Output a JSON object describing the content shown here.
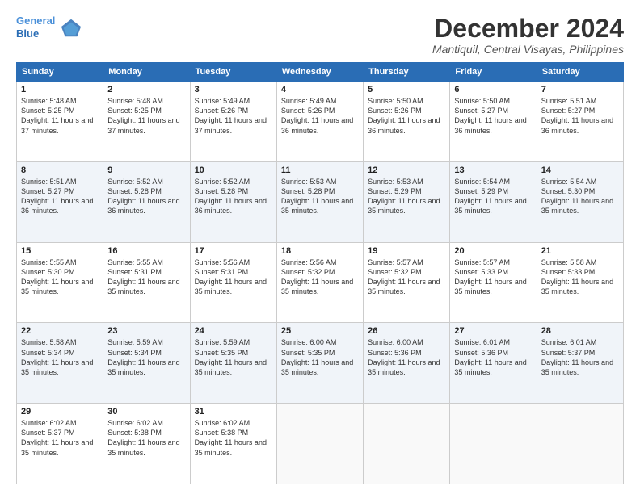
{
  "header": {
    "logo_line1": "General",
    "logo_line2": "Blue",
    "month": "December 2024",
    "location": "Mantiquil, Central Visayas, Philippines"
  },
  "weekdays": [
    "Sunday",
    "Monday",
    "Tuesday",
    "Wednesday",
    "Thursday",
    "Friday",
    "Saturday"
  ],
  "weeks": [
    [
      {
        "day": "1",
        "rise": "5:48 AM",
        "set": "5:25 PM",
        "daylight": "11 hours and 37 minutes."
      },
      {
        "day": "2",
        "rise": "5:48 AM",
        "set": "5:25 PM",
        "daylight": "11 hours and 37 minutes."
      },
      {
        "day": "3",
        "rise": "5:49 AM",
        "set": "5:26 PM",
        "daylight": "11 hours and 37 minutes."
      },
      {
        "day": "4",
        "rise": "5:49 AM",
        "set": "5:26 PM",
        "daylight": "11 hours and 36 minutes."
      },
      {
        "day": "5",
        "rise": "5:50 AM",
        "set": "5:26 PM",
        "daylight": "11 hours and 36 minutes."
      },
      {
        "day": "6",
        "rise": "5:50 AM",
        "set": "5:27 PM",
        "daylight": "11 hours and 36 minutes."
      },
      {
        "day": "7",
        "rise": "5:51 AM",
        "set": "5:27 PM",
        "daylight": "11 hours and 36 minutes."
      }
    ],
    [
      {
        "day": "8",
        "rise": "5:51 AM",
        "set": "5:27 PM",
        "daylight": "11 hours and 36 minutes."
      },
      {
        "day": "9",
        "rise": "5:52 AM",
        "set": "5:28 PM",
        "daylight": "11 hours and 36 minutes."
      },
      {
        "day": "10",
        "rise": "5:52 AM",
        "set": "5:28 PM",
        "daylight": "11 hours and 36 minutes."
      },
      {
        "day": "11",
        "rise": "5:53 AM",
        "set": "5:28 PM",
        "daylight": "11 hours and 35 minutes."
      },
      {
        "day": "12",
        "rise": "5:53 AM",
        "set": "5:29 PM",
        "daylight": "11 hours and 35 minutes."
      },
      {
        "day": "13",
        "rise": "5:54 AM",
        "set": "5:29 PM",
        "daylight": "11 hours and 35 minutes."
      },
      {
        "day": "14",
        "rise": "5:54 AM",
        "set": "5:30 PM",
        "daylight": "11 hours and 35 minutes."
      }
    ],
    [
      {
        "day": "15",
        "rise": "5:55 AM",
        "set": "5:30 PM",
        "daylight": "11 hours and 35 minutes."
      },
      {
        "day": "16",
        "rise": "5:55 AM",
        "set": "5:31 PM",
        "daylight": "11 hours and 35 minutes."
      },
      {
        "day": "17",
        "rise": "5:56 AM",
        "set": "5:31 PM",
        "daylight": "11 hours and 35 minutes."
      },
      {
        "day": "18",
        "rise": "5:56 AM",
        "set": "5:32 PM",
        "daylight": "11 hours and 35 minutes."
      },
      {
        "day": "19",
        "rise": "5:57 AM",
        "set": "5:32 PM",
        "daylight": "11 hours and 35 minutes."
      },
      {
        "day": "20",
        "rise": "5:57 AM",
        "set": "5:33 PM",
        "daylight": "11 hours and 35 minutes."
      },
      {
        "day": "21",
        "rise": "5:58 AM",
        "set": "5:33 PM",
        "daylight": "11 hours and 35 minutes."
      }
    ],
    [
      {
        "day": "22",
        "rise": "5:58 AM",
        "set": "5:34 PM",
        "daylight": "11 hours and 35 minutes."
      },
      {
        "day": "23",
        "rise": "5:59 AM",
        "set": "5:34 PM",
        "daylight": "11 hours and 35 minutes."
      },
      {
        "day": "24",
        "rise": "5:59 AM",
        "set": "5:35 PM",
        "daylight": "11 hours and 35 minutes."
      },
      {
        "day": "25",
        "rise": "6:00 AM",
        "set": "5:35 PM",
        "daylight": "11 hours and 35 minutes."
      },
      {
        "day": "26",
        "rise": "6:00 AM",
        "set": "5:36 PM",
        "daylight": "11 hours and 35 minutes."
      },
      {
        "day": "27",
        "rise": "6:01 AM",
        "set": "5:36 PM",
        "daylight": "11 hours and 35 minutes."
      },
      {
        "day": "28",
        "rise": "6:01 AM",
        "set": "5:37 PM",
        "daylight": "11 hours and 35 minutes."
      }
    ],
    [
      {
        "day": "29",
        "rise": "6:02 AM",
        "set": "5:37 PM",
        "daylight": "11 hours and 35 minutes."
      },
      {
        "day": "30",
        "rise": "6:02 AM",
        "set": "5:38 PM",
        "daylight": "11 hours and 35 minutes."
      },
      {
        "day": "31",
        "rise": "6:02 AM",
        "set": "5:38 PM",
        "daylight": "11 hours and 35 minutes."
      },
      null,
      null,
      null,
      null
    ]
  ]
}
